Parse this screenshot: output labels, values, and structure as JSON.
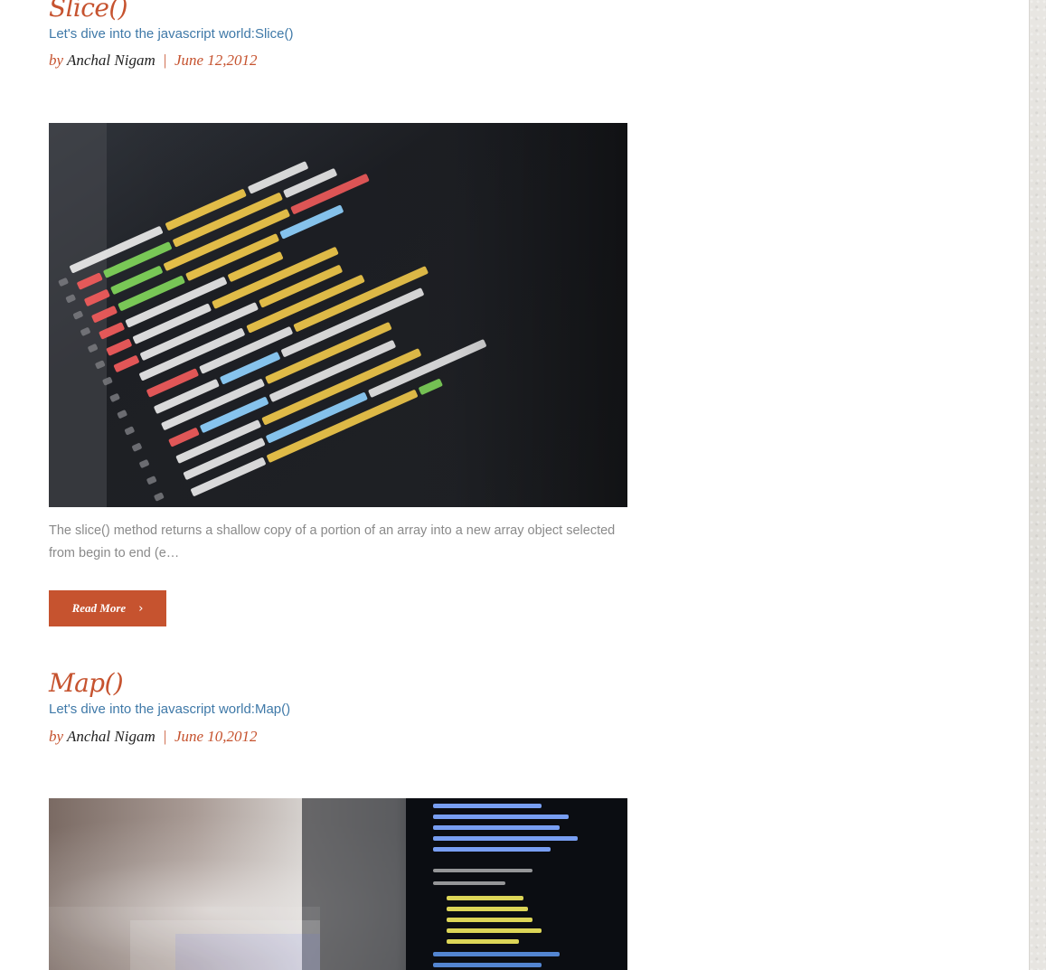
{
  "posts": [
    {
      "title": "Slice()",
      "subtitle": "Let's dive into the javascript world:Slice()",
      "by_label": "by",
      "author": "Anchal Nigam",
      "separator": "|",
      "date": "June 12,2012",
      "excerpt": "The slice() method returns a shallow copy of a portion of an array into a new array object selected from begin to end (e…",
      "read_more_label": "Read More",
      "read_more_icon": "chevron-right-icon"
    },
    {
      "title": "Map()",
      "subtitle": "Let's dive into the javascript world:Map()",
      "by_label": "by",
      "author": "Anchal Nigam",
      "separator": "|",
      "date": "June 10,2012"
    }
  ],
  "colors": {
    "accent": "#c6532f",
    "subtitle_link": "#3f79a8",
    "excerpt_text": "#8a8a8a",
    "author_text": "#1f1f1f",
    "background": "#ffffff",
    "sidebar_rail": "#e3e1dd"
  }
}
